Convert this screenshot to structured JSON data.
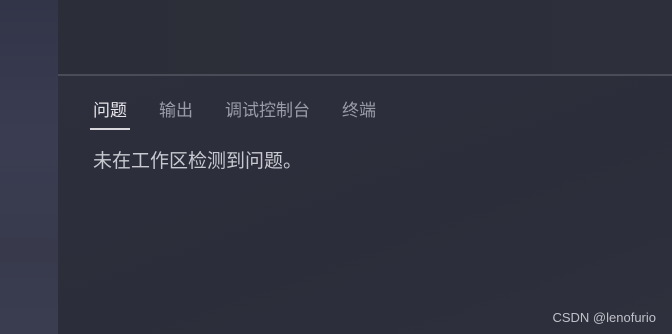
{
  "panel": {
    "tabs": [
      {
        "label": "问题",
        "active": true
      },
      {
        "label": "输出",
        "active": false
      },
      {
        "label": "调试控制台",
        "active": false
      },
      {
        "label": "终端",
        "active": false
      }
    ],
    "message": "未在工作区检测到问题。"
  },
  "watermark": "CSDN @lenofurio"
}
